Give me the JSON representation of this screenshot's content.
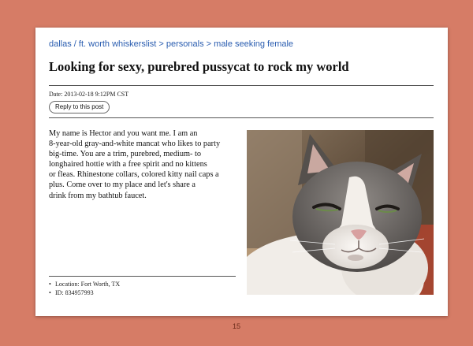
{
  "breadcrumb": [
    {
      "label": "dallas / ft. worth whiskerslist"
    },
    {
      "label": "personals"
    },
    {
      "label": "male seeking female"
    }
  ],
  "breadcrumb_separator": ">",
  "post": {
    "title": "Looking for sexy, purebred pussycat to rock my world",
    "date": "Date: 2013-02-18 9:12PM CST",
    "reply_label": "Reply to this post",
    "body_lines": [
      "My name is Hector and you want me. I am an",
      "8-year-old gray-and-white mancat who likes to party",
      "big-time. You are a trim, purebred, medium- to",
      "longhaired hottie with a free spirit and no kittens",
      "or fleas. Rhinestone collars, colored kitty nail caps a",
      "plus. Come over to my place and let's share a",
      "drink from my bathtub faucet."
    ],
    "attributes": [
      "Location: Fort Worth, TX",
      "ID: 834957993"
    ],
    "bullet": "•"
  },
  "page_number": "15",
  "colors": {
    "background": "#d67c66",
    "link": "#2a5db0",
    "card": "#ffffff"
  }
}
